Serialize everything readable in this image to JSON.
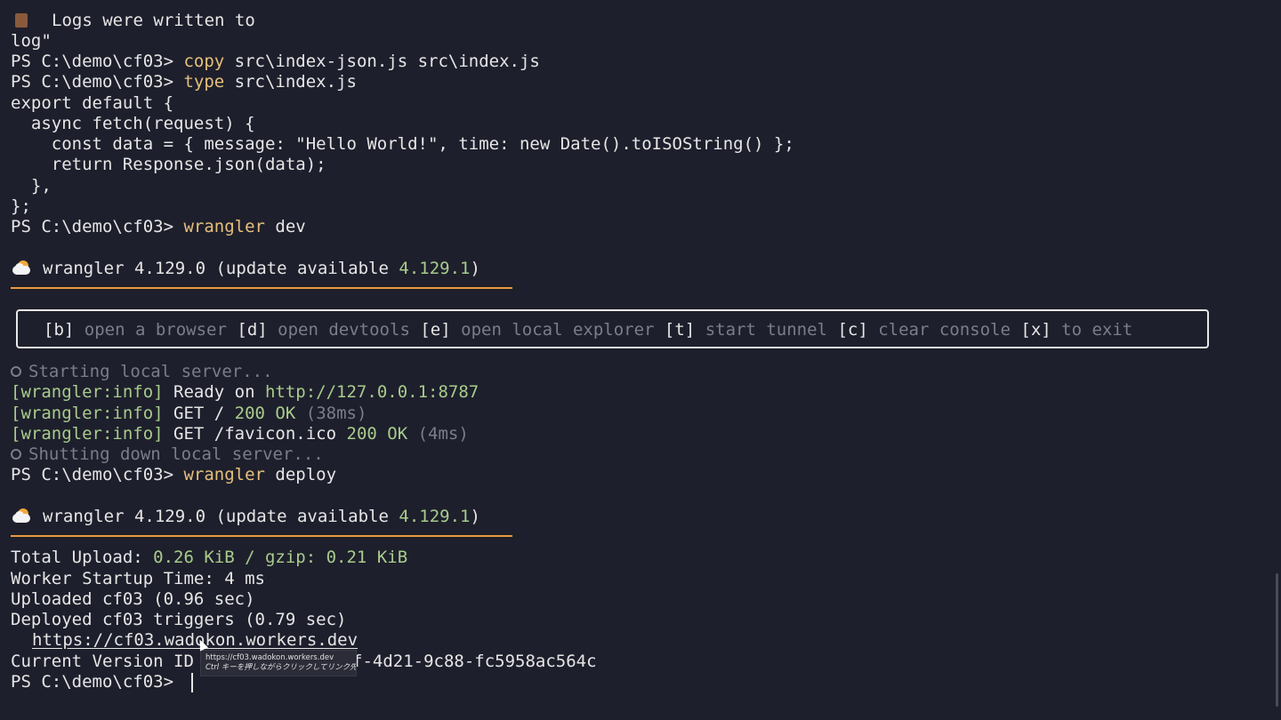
{
  "top": {
    "log_text": "Logs were written to",
    "log_cont": "log\""
  },
  "prompt": "PS C:\\demo\\cf03> ",
  "commands": {
    "copy_cmd": "copy",
    "copy_args": " src\\index-json.js src\\index.js",
    "type_cmd": "type",
    "type_args": " src\\index.js",
    "dev_cmd": "wrangler",
    "dev_args": " dev",
    "deploy_cmd": "wrangler",
    "deploy_args": " deploy"
  },
  "code": {
    "line1": "export default {",
    "line2": "  async fetch(request) {",
    "line3": "    const data = { message: \"Hello World!\", time: new Date().toISOString() };",
    "line4": "    return Response.json(data);",
    "line5": "  },",
    "line6": "};"
  },
  "banner": {
    "version_text": "wrangler 4.129.0 (update available ",
    "update_version": "4.129.1",
    "close_paren": ")"
  },
  "hotkeys": [
    {
      "key": "[b]",
      "desc": "open a browser"
    },
    {
      "key": "[d]",
      "desc": "open devtools"
    },
    {
      "key": "[e]",
      "desc": "open local explorer"
    },
    {
      "key": "[t]",
      "desc": "start tunnel"
    },
    {
      "key": "[c]",
      "desc": "clear console"
    },
    {
      "key": "[x]",
      "desc": "to exit"
    }
  ],
  "dev_log": {
    "starting": "Starting local server...",
    "tag": "[wrangler:info]",
    "ready_text": " Ready on ",
    "ready_url": "http://127.0.0.1:8787",
    "get1_path": " GET / ",
    "get1_status": "200 OK",
    "get1_time": " (38ms)",
    "get2_path": " GET /favicon.ico ",
    "get2_status": "200 OK",
    "get2_time": " (4ms)",
    "shutting": "Shutting down local server..."
  },
  "deploy_log": {
    "upload_label": "Total Upload: ",
    "upload_value": "0.26 KiB / gzip: 0.21 KiB",
    "startup": "Worker Startup Time: 4 ms",
    "uploaded": "Uploaded cf03 (0.96 sec)",
    "deployed": "Deployed cf03 triggers (0.79 sec)",
    "worker_url": "https://cf03.wadokon.workers.dev",
    "version_label": "Current Version ID",
    "version_suffix": "f-4d21-9c88-fc5958ac564c"
  },
  "tooltip": {
    "url": "https://cf03.wadokon.workers.dev",
    "hint": "Ctrl キーを押しながらクリックしてリンク先を表示"
  },
  "colors": {
    "background": "#1e1f2c",
    "command": "#e5c07b",
    "success": "#a8cc8c",
    "dim": "#7a7d8c",
    "rule": "#e89a3c"
  }
}
